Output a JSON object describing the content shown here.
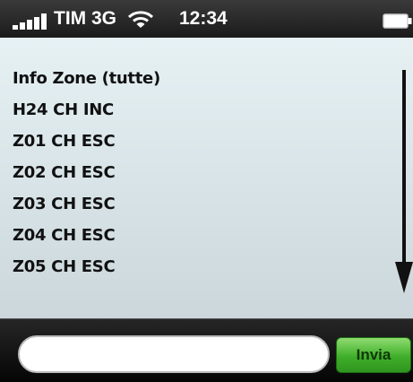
{
  "status_bar": {
    "carrier": "TIM 3G",
    "time": "12:34",
    "signal_icon": "signal-bars-icon",
    "wifi_icon": "wifi-icon",
    "battery_icon": "battery-icon"
  },
  "messages": [
    "Info Zone (tutte)",
    "H24 CH INC",
    "Z01 CH ESC",
    "Z02 CH ESC",
    "Z03 CH ESC",
    "Z04 CH ESC",
    "Z05 CH ESC"
  ],
  "scroll_indicator_icon": "arrow-down-icon",
  "input_bar": {
    "text_value": "",
    "send_label": "Invia"
  },
  "colors": {
    "send_button": "#3fae2a",
    "list_background": "#e6f1f4"
  }
}
